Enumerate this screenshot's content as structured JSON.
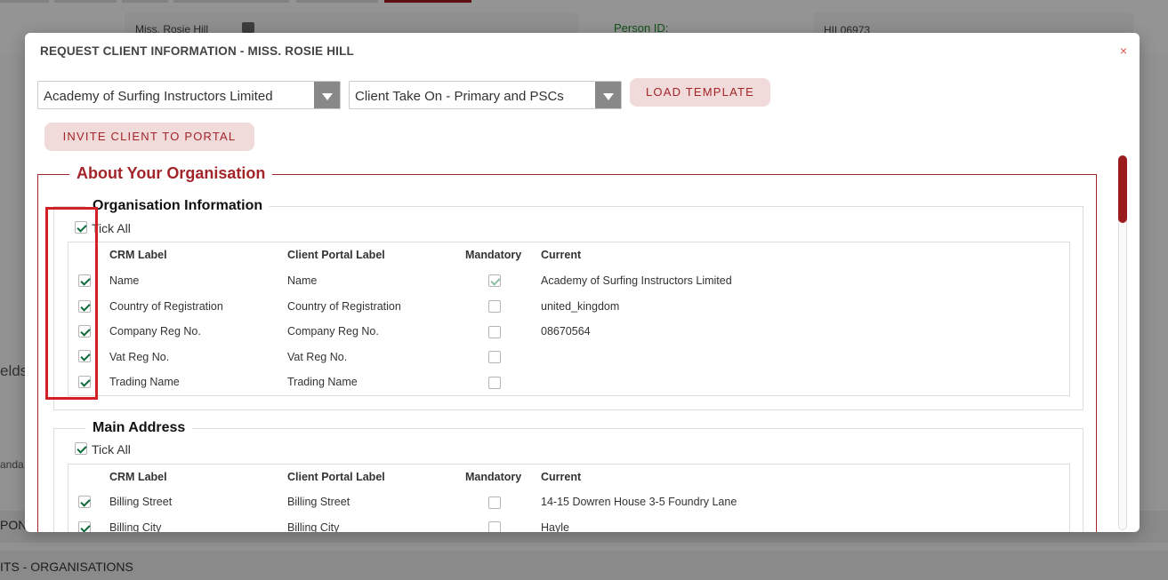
{
  "background": {
    "client_name": "Miss. Rosie Hill",
    "person_id_label": "Person ID:",
    "person_id_value": "HIL06973",
    "fields_fragment": "elds",
    "standard_fragment": "anda",
    "band1_text": "PON",
    "band2_text": "ITS - ORGANISATIONS"
  },
  "modal": {
    "title": "REQUEST CLIENT INFORMATION - MISS. ROSIE HILL",
    "close_icon": "×",
    "organisation_select": "Academy of Surfing Instructors Limited",
    "template_select": "Client Take On - Primary and PSCs",
    "load_template_label": "LOAD TEMPLATE",
    "invite_label": "INVITE CLIENT TO PORTAL",
    "section_title": "About Your Organisation",
    "tick_all_label": "Tick All",
    "columns": {
      "crm": "CRM Label",
      "portal": "Client Portal Label",
      "mandatory": "Mandatory",
      "current": "Current"
    },
    "groups": [
      {
        "title": "Organisation Information",
        "rows": [
          {
            "crm": "Name",
            "portal": "Name",
            "mandatory": true,
            "current": "Academy of Surfing Instructors Limited"
          },
          {
            "crm": "Country of Registration",
            "portal": "Country of Registration",
            "mandatory": false,
            "current": "united_kingdom"
          },
          {
            "crm": "Company Reg No.",
            "portal": "Company Reg No.",
            "mandatory": false,
            "current": "08670564"
          },
          {
            "crm": "Vat Reg No.",
            "portal": "Vat Reg No.",
            "mandatory": false,
            "current": ""
          },
          {
            "crm": "Trading Name",
            "portal": "Trading Name",
            "mandatory": false,
            "current": ""
          }
        ]
      },
      {
        "title": "Main Address",
        "rows": [
          {
            "crm": "Billing Street",
            "portal": "Billing Street",
            "mandatory": false,
            "current": "14-15 Dowren House 3-5 Foundry Lane"
          },
          {
            "crm": "Billing City",
            "portal": "Billing City",
            "mandatory": false,
            "current": "Hayle"
          }
        ]
      }
    ]
  },
  "colors": {
    "accent": "#a3252a",
    "check": "#0d6b3b",
    "highlight": "#d51f26"
  }
}
